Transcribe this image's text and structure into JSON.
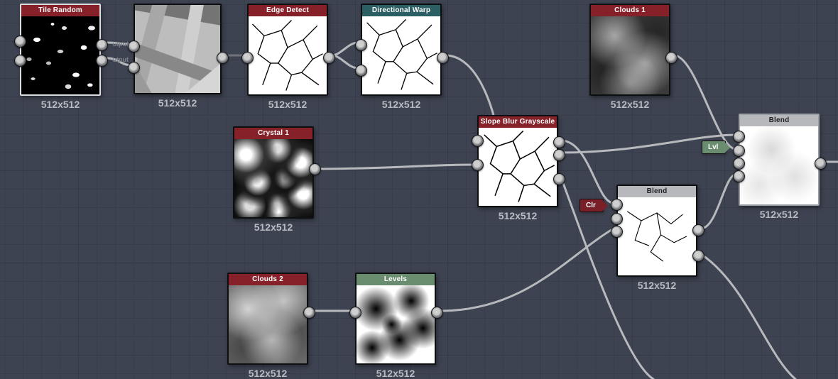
{
  "labels": {
    "output": "utput"
  },
  "badges": {
    "clr": "Clr",
    "lvl": "Lvl"
  },
  "nodes": {
    "tile_random": {
      "title": "Tile Random",
      "res": "512x512",
      "header": "red",
      "selected": true,
      "inputs": 2,
      "outputs": 2
    },
    "unnamed": {
      "title": "",
      "res": "512x512",
      "header": "none",
      "inputs": 2,
      "outputs": 1
    },
    "edge_detect": {
      "title": "Edge Detect",
      "res": "512x512",
      "header": "red",
      "inputs": 1,
      "outputs": 1
    },
    "dir_warp": {
      "title": "Directional Warp",
      "res": "512x512",
      "header": "teal",
      "inputs": 2,
      "outputs": 1
    },
    "clouds1": {
      "title": "Clouds 1",
      "res": "512x512",
      "header": "red",
      "inputs": 0,
      "outputs": 1
    },
    "crystal1": {
      "title": "Crystal 1",
      "res": "512x512",
      "header": "red",
      "inputs": 0,
      "outputs": 1
    },
    "slope": {
      "title": "Slope Blur Grayscale",
      "res": "512x512",
      "header": "red",
      "inputs": 2,
      "outputs": 3
    },
    "blend1": {
      "title": "Blend",
      "res": "512x512",
      "header": "grey",
      "inputs": 3,
      "outputs": 2
    },
    "blend2": {
      "title": "Blend",
      "res": "512x512",
      "header": "grey",
      "inputs": 4,
      "outputs": 1
    },
    "clouds2": {
      "title": "Clouds 2",
      "res": "512x512",
      "header": "red",
      "inputs": 0,
      "outputs": 1
    },
    "levels": {
      "title": "Levels",
      "res": "512x512",
      "header": "green",
      "inputs": 1,
      "outputs": 1
    }
  },
  "connections": [
    [
      "tile_random",
      "unnamed"
    ],
    [
      "tile_random",
      "unnamed"
    ],
    [
      "unnamed",
      "edge_detect"
    ],
    [
      "edge_detect",
      "dir_warp"
    ],
    [
      "edge_detect",
      "dir_warp"
    ],
    [
      "dir_warp",
      "slope"
    ],
    [
      "crystal1",
      "slope"
    ],
    [
      "slope",
      "blend1"
    ],
    [
      "slope",
      "blend2"
    ],
    [
      "clouds1",
      "blend2"
    ],
    [
      "blend1",
      "blend2"
    ],
    [
      "clouds2",
      "levels"
    ],
    [
      "levels",
      "blend1"
    ]
  ],
  "colors": {
    "bg": "#3e4351",
    "header_red": "#86212a",
    "header_teal": "#2c5f63",
    "header_grey": "#b6b8bb",
    "header_green": "#6a8d6f",
    "wire": "#b7b9bd"
  }
}
